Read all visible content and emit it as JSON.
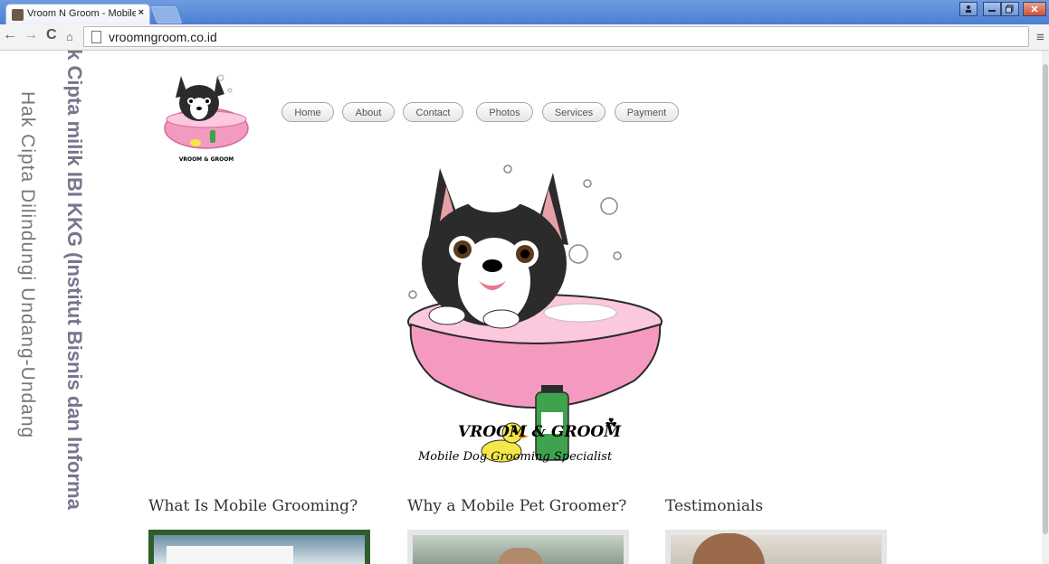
{
  "browser": {
    "tab_title": "Vroom N Groom - Mobile",
    "tab_close": "×",
    "url": "vroomngroom.co.id",
    "back": "←",
    "forward": "→",
    "reload": "C",
    "menu": "≡"
  },
  "nav": {
    "items": [
      "Home",
      "About",
      "Contact",
      "Photos",
      "Services",
      "Payment"
    ]
  },
  "logo": {
    "title": "VROOM & GROOM",
    "tagline": "Mobile Dog Grooming Specialist",
    "small_text": "VROOM & GROOM"
  },
  "sections": [
    {
      "title": "What Is Mobile Grooming?"
    },
    {
      "title": "Why a Mobile Pet Groomer?"
    },
    {
      "title": "Testimonials"
    }
  ],
  "watermark": {
    "light": "Hak Cipta Dilindungi Undang-Undang",
    "dark": "Hak Cipta milik IBI KKG (Institut Bisnis dan Informa"
  },
  "colors": {
    "tub_pink": "#f49ac1",
    "titlebar_blue": "#4a7fd2",
    "bottle_green": "#3fa34d",
    "duck_yellow": "#f5e64a"
  }
}
